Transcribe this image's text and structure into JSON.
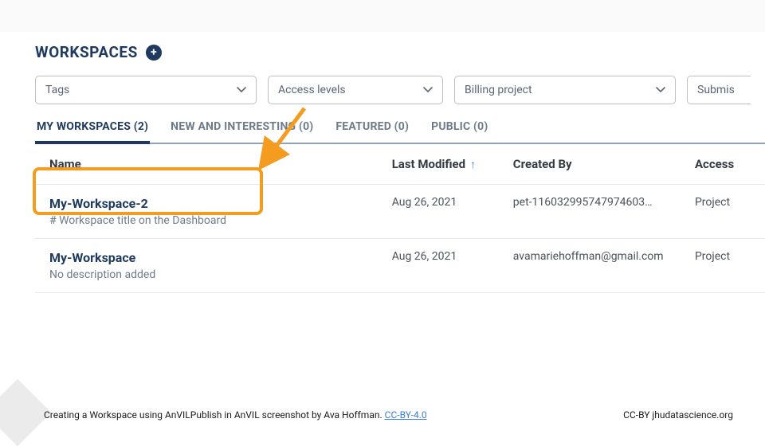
{
  "header": {
    "title": "WORKSPACES",
    "add_label": "+"
  },
  "filters": {
    "tags": "Tags",
    "access": "Access levels",
    "billing": "Billing project",
    "submission": "Submis"
  },
  "tabs": [
    {
      "label": "MY WORKSPACES (2)",
      "active": true
    },
    {
      "label": "NEW AND INTERESTING (0)",
      "active": false
    },
    {
      "label": "FEATURED (0)",
      "active": false
    },
    {
      "label": "PUBLIC (0)",
      "active": false
    }
  ],
  "columns": {
    "name": "Name",
    "modified": "Last Modified",
    "created": "Created By",
    "access": "Access"
  },
  "rows": [
    {
      "name": "My-Workspace-2",
      "desc": "# Workspace title on the Dashboard",
      "modified": "Aug 26, 2021",
      "created": "pet-116032995747974603…",
      "access": "Project"
    },
    {
      "name": "My-Workspace",
      "desc": "No description added",
      "modified": "Aug 26, 2021",
      "created": "avamariehoffman@gmail.com",
      "access": "Project"
    }
  ],
  "footer": {
    "caption": "Creating a Workspace using AnVILPublish in AnVIL screenshot by Ava Hoffman.",
    "license_link": "CC-BY-4.0",
    "right": "CC-BY  jhudatascience.org"
  }
}
